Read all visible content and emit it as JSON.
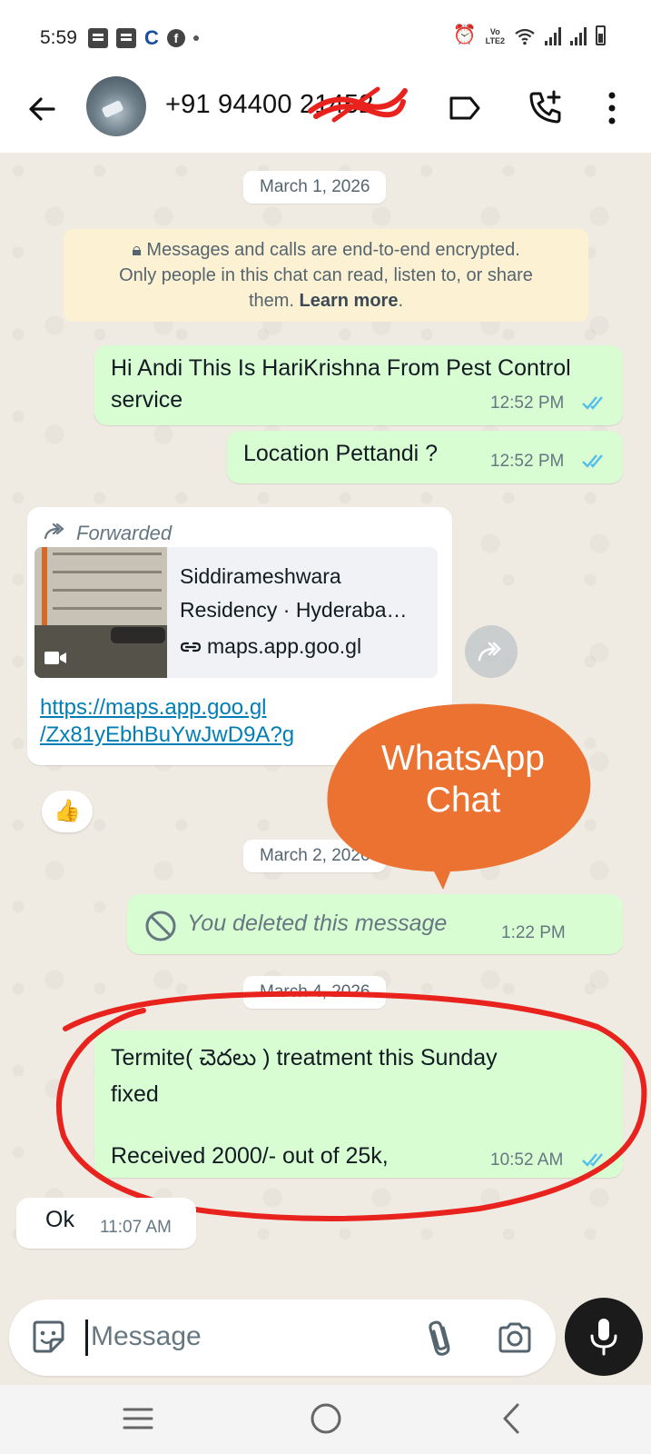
{
  "status_bar": {
    "time": "5:59",
    "network_label": "VoLTE2"
  },
  "header": {
    "contact_name": "+91 94400 21452",
    "icons": [
      "back-arrow-icon",
      "avatar",
      "label-icon",
      "call-add-icon",
      "more-vert-icon"
    ]
  },
  "chat": {
    "date_1": "March 1, 2026",
    "encryption_notice": {
      "line1": "Messages and calls are end-to-end encrypted.",
      "line2": "Only people in this chat can read, listen to, or share",
      "line3": "them. ",
      "learn_more": "Learn more",
      "line3_end": "."
    },
    "messages": [
      {
        "direction": "out",
        "text": "Hi Andi This Is HariKrishna From Pest Control service",
        "time": "12:52 PM",
        "status": "read"
      },
      {
        "direction": "out",
        "text": "Location  Pettandi ?",
        "time": "12:52 PM",
        "status": "read"
      },
      {
        "direction": "in",
        "forwarded_label": "Forwarded",
        "link_preview": {
          "title_line1": "Siddirameshwara",
          "title_line2": "Residency · Hyderaba…",
          "domain": "maps.app.goo.gl"
        },
        "url_line1": "https://maps.app.goo.gl",
        "url_line2": "/Zx81yEbhBuYwJwD9A?g",
        "reaction": "👍"
      },
      {
        "direction": "out",
        "deleted": true,
        "text": "You deleted this message",
        "time": "1:22 PM"
      },
      {
        "direction": "out",
        "line1": "Termite( చెదలు ) treatment this Sunday",
        "line2": "fixed",
        "line3": "Received 2000/- out of 25k,",
        "time": "10:52 AM",
        "status": "read"
      },
      {
        "direction": "in",
        "text": "Ok",
        "time": "11:07 AM"
      }
    ],
    "date_2": "March 2, 2026",
    "date_3": "March 4, 2026",
    "overlay_annotation": {
      "line1": "WhatsApp",
      "line2": "Chat",
      "color": "#ec7231"
    },
    "highlight_circle_color": "#e8231e"
  },
  "composer": {
    "placeholder": "Message"
  },
  "colors": {
    "outgoing_bubble": "#d9fdd3",
    "incoming_bubble": "#ffffff",
    "read_ticks": "#53bdeb",
    "link": "#027eb5"
  }
}
